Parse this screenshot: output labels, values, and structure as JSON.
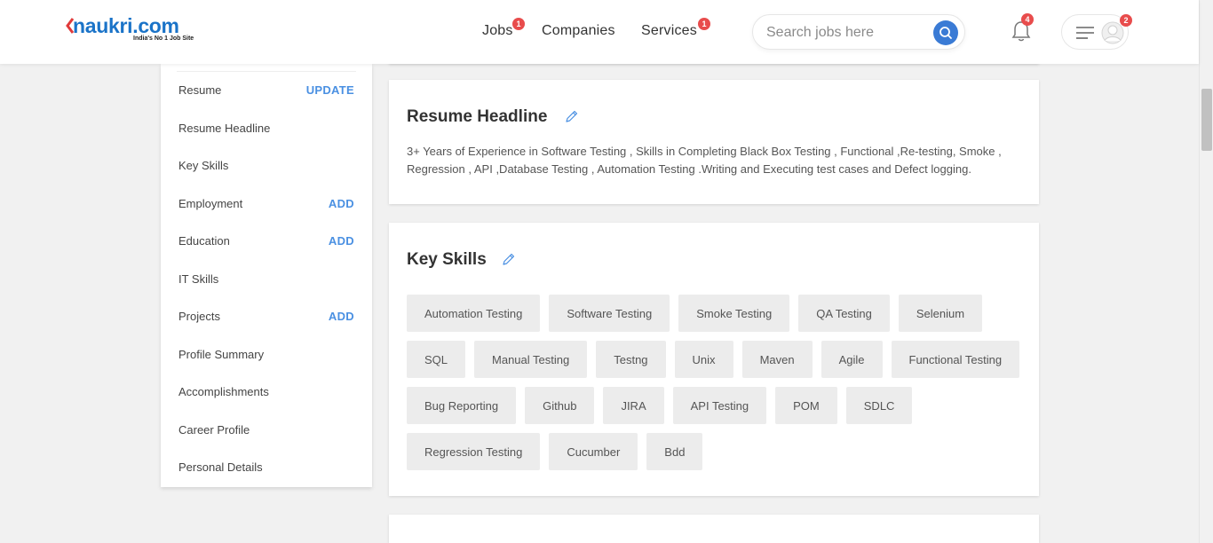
{
  "header": {
    "logo_text": "naukri.com",
    "logo_tagline": "India's No 1 Job Site",
    "nav": [
      {
        "label": "Jobs",
        "badge": "1"
      },
      {
        "label": "Companies",
        "badge": ""
      },
      {
        "label": "Services",
        "badge": "1"
      }
    ],
    "search_placeholder": "Search jobs here",
    "notification_count": "4",
    "menu_badge": "2"
  },
  "sidebar": {
    "items": [
      {
        "label": "Resume",
        "action": "UPDATE"
      },
      {
        "label": "Resume Headline",
        "action": ""
      },
      {
        "label": "Key Skills",
        "action": ""
      },
      {
        "label": "Employment",
        "action": "ADD"
      },
      {
        "label": "Education",
        "action": "ADD"
      },
      {
        "label": "IT Skills",
        "action": ""
      },
      {
        "label": "Projects",
        "action": "ADD"
      },
      {
        "label": "Profile Summary",
        "action": ""
      },
      {
        "label": "Accomplishments",
        "action": ""
      },
      {
        "label": "Career Profile",
        "action": ""
      },
      {
        "label": "Personal Details",
        "action": ""
      }
    ]
  },
  "resume_headline": {
    "title": "Resume Headline",
    "text": "3+ Years of Experience in Software Testing , Skills in Completing Black Box Testing , Functional ,Re-testing, Smoke , Regression , API ,Database Testing , Automation Testing .Writing and Executing test cases and Defect logging."
  },
  "key_skills": {
    "title": "Key Skills",
    "skills": [
      "Automation Testing",
      "Software Testing",
      "Smoke Testing",
      "QA Testing",
      "Selenium",
      "SQL",
      "Manual Testing",
      "Testng",
      "Unix",
      "Maven",
      "Agile",
      "Functional Testing",
      "Bug Reporting",
      "Github",
      "JIRA",
      "API Testing",
      "POM",
      "SDLC",
      "Regression Testing",
      "Cucumber",
      "Bdd"
    ]
  },
  "colors": {
    "brand_blue": "#1a73c8",
    "accent_blue": "#4a90e2",
    "badge_red": "#e84c4c"
  }
}
